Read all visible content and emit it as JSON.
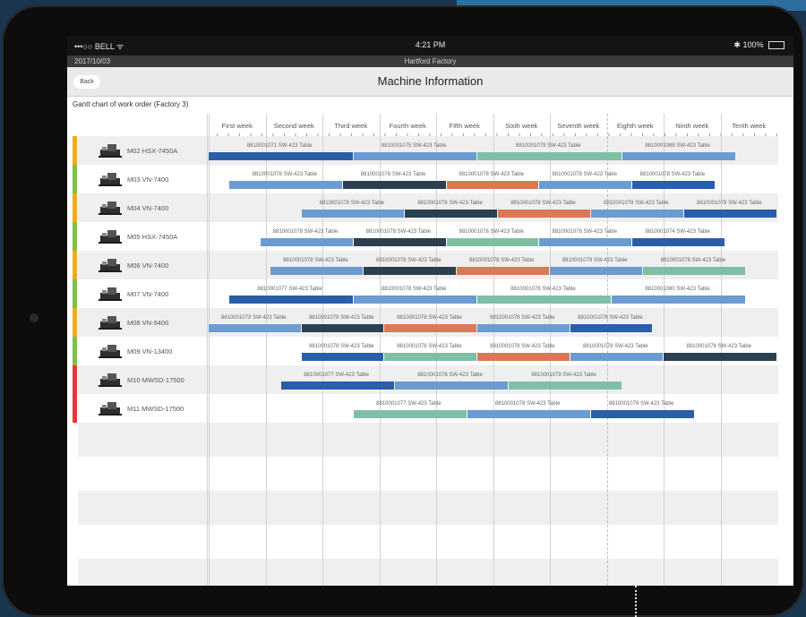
{
  "status_bar": {
    "carrier": "•••○○ BELL ᯤ",
    "time": "4:21 PM",
    "battery": "100%"
  },
  "sub_bar": {
    "left_text": "2017/10/03",
    "center_text": "Hartford Factory"
  },
  "nav": {
    "back_label": "Back",
    "title": "Machine Information"
  },
  "gantt": {
    "label": "Gantt chart of work order (Factory 3)",
    "weeks": [
      "First week",
      "Second week",
      "Third week",
      "Fourth week",
      "Fifth week",
      "Sixth week",
      "Seventh week",
      "Eighth week",
      "Ninth week",
      "Tenth week"
    ]
  },
  "machines": [
    {
      "label": "M02 HSX-7450A",
      "status_color": "#f5a623"
    },
    {
      "label": "M03 VN-7400",
      "status_color": "#7dc242"
    },
    {
      "label": "M04 VN-7400",
      "status_color": "#f5a623"
    },
    {
      "label": "M05 HSX-7450A",
      "status_color": "#7dc242"
    },
    {
      "label": "M06 VN-7400",
      "status_color": "#f5a623"
    },
    {
      "label": "M07 VN-7400",
      "status_color": "#7dc242"
    },
    {
      "label": "M08 VN-9400",
      "status_color": "#f5a623"
    },
    {
      "label": "M09 VN-13400",
      "status_color": "#7dc242"
    },
    {
      "label": "M10 MWSD-17500",
      "status_color": "#e53935"
    },
    {
      "label": "M11 MWSD-17500",
      "status_color": "#e53935"
    }
  ],
  "task_colors": {
    "blue": "#2a5ea8",
    "light_blue": "#6b9bd1",
    "teal": "#7fbfa5",
    "dark": "#2b3f4f",
    "orange": "#d97a55"
  },
  "tasks": [
    {
      "row": 0,
      "start": 0.0,
      "end": 0.7,
      "color": "blue",
      "label": "8810001071 SW-423 Table"
    },
    {
      "row": 0,
      "start": 0.7,
      "end": 1.3,
      "color": "light_blue",
      "label": "8810001075 SW-423 Table"
    },
    {
      "row": 0,
      "start": 1.3,
      "end": 2.0,
      "color": "teal",
      "label": "8810001079 SW-423 Table"
    },
    {
      "row": 0,
      "start": 2.0,
      "end": 2.55,
      "color": "light_blue",
      "label": "8810001088 SW-423 Table"
    },
    {
      "row": 1,
      "start": 0.1,
      "end": 0.65,
      "color": "light_blue",
      "label": "8810001078 SW-423 Table"
    },
    {
      "row": 1,
      "start": 0.65,
      "end": 1.15,
      "color": "dark",
      "label": "8810001078 SW-423 Table"
    },
    {
      "row": 1,
      "start": 1.15,
      "end": 1.6,
      "color": "orange",
      "label": "8810001078 SW-423 Table"
    },
    {
      "row": 1,
      "start": 1.6,
      "end": 2.05,
      "color": "light_blue",
      "label": "8810001078 SW-423 Table"
    },
    {
      "row": 1,
      "start": 2.05,
      "end": 2.45,
      "color": "blue",
      "label": "8810001078 SW-423 Table"
    },
    {
      "row": 2,
      "start": 0.45,
      "end": 0.95,
      "color": "light_blue",
      "label": "8810001078 SW-423 Table"
    },
    {
      "row": 2,
      "start": 0.95,
      "end": 1.4,
      "color": "dark",
      "label": "8810001078 SW-423 Table"
    },
    {
      "row": 2,
      "start": 1.4,
      "end": 1.85,
      "color": "orange",
      "label": "8810001078 SW-423 Table"
    },
    {
      "row": 2,
      "start": 1.85,
      "end": 2.3,
      "color": "light_blue",
      "label": "8810001078 SW-423 Table"
    },
    {
      "row": 2,
      "start": 2.3,
      "end": 2.75,
      "color": "blue",
      "label": "8810001078 SW-423 Table"
    },
    {
      "row": 3,
      "start": 0.25,
      "end": 0.7,
      "color": "light_blue",
      "label": "8810001078 SW-423 Table"
    },
    {
      "row": 3,
      "start": 0.7,
      "end": 1.15,
      "color": "dark",
      "label": "8810001078 SW-423 Table"
    },
    {
      "row": 3,
      "start": 1.15,
      "end": 1.6,
      "color": "teal",
      "label": "8810001078 SW-423 Table"
    },
    {
      "row": 3,
      "start": 1.6,
      "end": 2.05,
      "color": "light_blue",
      "label": "8810001078 SW-423 Table"
    },
    {
      "row": 3,
      "start": 2.05,
      "end": 2.5,
      "color": "blue",
      "label": "8810001074 SW-423 Table"
    },
    {
      "row": 4,
      "start": 0.3,
      "end": 0.75,
      "color": "light_blue",
      "label": "8810001078 SW-423 Table"
    },
    {
      "row": 4,
      "start": 0.75,
      "end": 1.2,
      "color": "dark",
      "label": "8810001078 SW-423 Table"
    },
    {
      "row": 4,
      "start": 1.2,
      "end": 1.65,
      "color": "orange",
      "label": "8810001078 SW-423 Table"
    },
    {
      "row": 4,
      "start": 1.65,
      "end": 2.1,
      "color": "light_blue",
      "label": "8810001078 SW-423 Table"
    },
    {
      "row": 4,
      "start": 2.1,
      "end": 2.6,
      "color": "teal",
      "label": "8810001078 SW-423 Table"
    },
    {
      "row": 5,
      "start": 0.1,
      "end": 0.7,
      "color": "blue",
      "label": "8810001077 SW-423 Table"
    },
    {
      "row": 5,
      "start": 0.7,
      "end": 1.3,
      "color": "light_blue",
      "label": "8810001078 SW-423 Table"
    },
    {
      "row": 5,
      "start": 1.3,
      "end": 1.95,
      "color": "teal",
      "label": "8810001078 SW-423 Table"
    },
    {
      "row": 5,
      "start": 1.95,
      "end": 2.6,
      "color": "light_blue",
      "label": "8810001080 SW-423 Table"
    },
    {
      "row": 6,
      "start": 0.0,
      "end": 0.45,
      "color": "light_blue",
      "label": "8810001073 SW-423 Table"
    },
    {
      "row": 6,
      "start": 0.45,
      "end": 0.85,
      "color": "dark",
      "label": "8810001078 SW-423 Table"
    },
    {
      "row": 6,
      "start": 0.85,
      "end": 1.3,
      "color": "orange",
      "label": "8810001078 SW-423 Table"
    },
    {
      "row": 6,
      "start": 1.3,
      "end": 1.75,
      "color": "light_blue",
      "label": "8810001078 SW-423 Table"
    },
    {
      "row": 6,
      "start": 1.75,
      "end": 2.15,
      "color": "blue",
      "label": "8810001078 SW-423 Table"
    },
    {
      "row": 7,
      "start": 0.45,
      "end": 0.85,
      "color": "blue",
      "label": "8810001078 SW-423 Table"
    },
    {
      "row": 7,
      "start": 0.85,
      "end": 1.3,
      "color": "teal",
      "label": "8810001078 SW-423 Table"
    },
    {
      "row": 7,
      "start": 1.3,
      "end": 1.75,
      "color": "orange",
      "label": "8810001078 SW-423 Table"
    },
    {
      "row": 7,
      "start": 1.75,
      "end": 2.2,
      "color": "light_blue",
      "label": "8810001078 SW-423 Table"
    },
    {
      "row": 7,
      "start": 2.2,
      "end": 2.75,
      "color": "dark",
      "label": "8810001078 SW-423 Table"
    },
    {
      "row": 8,
      "start": 0.35,
      "end": 0.9,
      "color": "blue",
      "label": "8810001077 SW-423 Table"
    },
    {
      "row": 8,
      "start": 0.9,
      "end": 1.45,
      "color": "light_blue",
      "label": "8810001078 SW-423 Table"
    },
    {
      "row": 8,
      "start": 1.45,
      "end": 2.0,
      "color": "teal",
      "label": "8810001079 SW-423 Table"
    },
    {
      "row": 9,
      "start": 0.7,
      "end": 1.25,
      "color": "teal",
      "label": "8810001077 SW-423 Table"
    },
    {
      "row": 9,
      "start": 1.25,
      "end": 1.85,
      "color": "light_blue",
      "label": "8810001078 SW-423 Table"
    },
    {
      "row": 9,
      "start": 1.85,
      "end": 2.35,
      "color": "blue",
      "label": "8810001079 SW-423 Table"
    }
  ]
}
